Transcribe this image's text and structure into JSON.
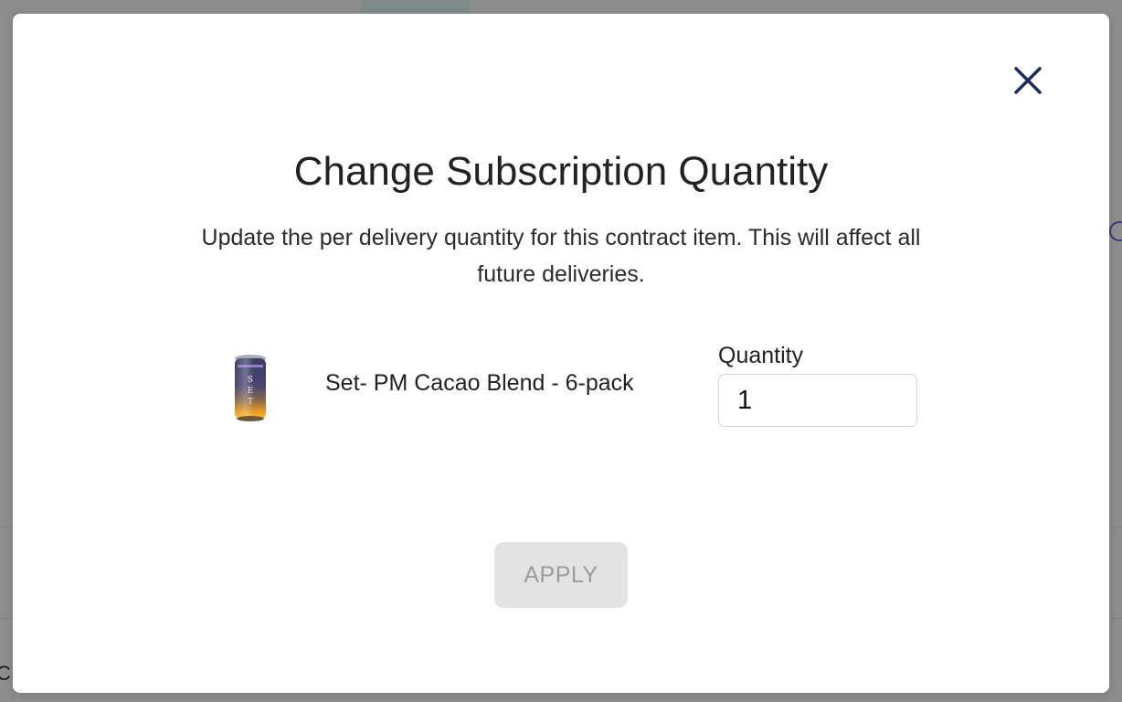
{
  "modal": {
    "title": "Change Subscription Quantity",
    "description": "Update the per delivery quantity for this contract item. This will affect all future deliveries.",
    "close_icon": "close-icon"
  },
  "item": {
    "product_name": "Set- PM Cacao Blend - 6-pack",
    "thumbnail": "can-product-image",
    "can_letters": [
      "S",
      "E",
      "T"
    ]
  },
  "quantity": {
    "label": "Quantity",
    "value": "1"
  },
  "actions": {
    "apply_label": "APPLY",
    "apply_disabled": true
  },
  "background": {
    "partial_text": "C"
  },
  "colors": {
    "close_icon": "#1d2a5a",
    "apply_bg": "#e3e3e3",
    "apply_text": "#9b9b9b",
    "overlay": "#8e8e8e"
  }
}
